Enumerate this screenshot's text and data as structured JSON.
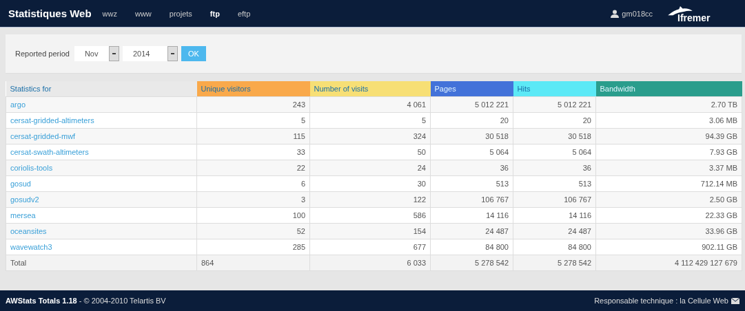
{
  "navbar": {
    "title": "Statistiques Web",
    "links": [
      {
        "label": "wwz",
        "selected": false
      },
      {
        "label": "www",
        "selected": false
      },
      {
        "label": "projets",
        "selected": false
      },
      {
        "label": "ftp",
        "selected": true
      },
      {
        "label": "eftp",
        "selected": false
      }
    ],
    "user": "gm018cc",
    "logo": "Ifremer"
  },
  "period": {
    "label": "Reported period",
    "month": "Nov",
    "year": "2014",
    "button": "OK"
  },
  "table": {
    "columns": [
      {
        "label": "Statistics for",
        "color": "#e9e9e9"
      },
      {
        "label": "Unique visitors",
        "color": "#f9a94b"
      },
      {
        "label": "Number of visits",
        "color": "#f7df75"
      },
      {
        "label": "Pages",
        "color": "#4372d9"
      },
      {
        "label": "Hits",
        "color": "#5ce9f6"
      },
      {
        "label": "Bandwidth",
        "color": "#2a9d8c"
      }
    ],
    "rows": [
      [
        "argo",
        "243",
        "4 061",
        "5 012 221",
        "5 012 221",
        "2.70 TB"
      ],
      [
        "cersat-gridded-altimeters",
        "5",
        "5",
        "20",
        "20",
        "3.06 MB"
      ],
      [
        "cersat-gridded-mwf",
        "115",
        "324",
        "30 518",
        "30 518",
        "94.39 GB"
      ],
      [
        "cersat-swath-altimeters",
        "33",
        "50",
        "5 064",
        "5 064",
        "7.93 GB"
      ],
      [
        "coriolis-tools",
        "22",
        "24",
        "36",
        "36",
        "3.37 MB"
      ],
      [
        "gosud",
        "6",
        "30",
        "513",
        "513",
        "712.14 MB"
      ],
      [
        "gosudv2",
        "3",
        "122",
        "106 767",
        "106 767",
        "2.50 GB"
      ],
      [
        "mersea",
        "100",
        "586",
        "14 116",
        "14 116",
        "22.33 GB"
      ],
      [
        "oceansites",
        "52",
        "154",
        "24 487",
        "24 487",
        "33.96 GB"
      ],
      [
        "wavewatch3",
        "285",
        "677",
        "84 800",
        "84 800",
        "902.11 GB"
      ]
    ],
    "total": [
      "Total",
      "864",
      "6 033",
      "5 278 542",
      "5 278 542",
      "4 112 429 127 679"
    ]
  },
  "footer": {
    "credits": "**AWStats Totals 1.18** - © 2004-2010 Telartis BV",
    "contact": "Responsable technique : la Cellule Web"
  }
}
